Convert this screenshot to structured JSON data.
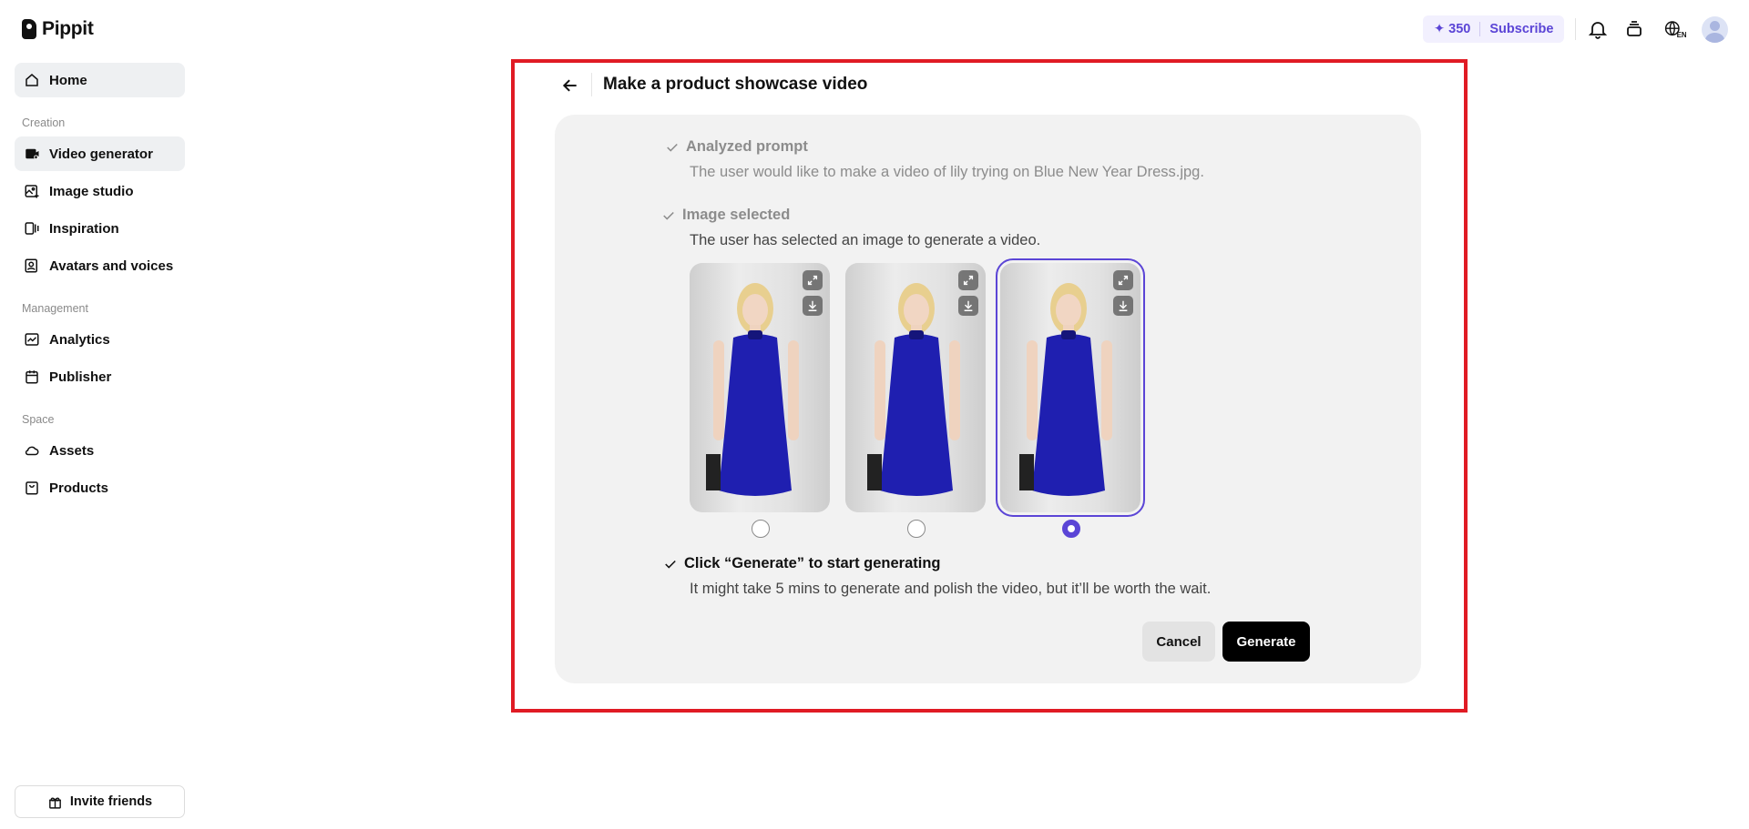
{
  "app": {
    "logo_text": "Pippit"
  },
  "sidebar": {
    "home": "Home",
    "creation_label": "Creation",
    "video_generator": "Video generator",
    "image_studio": "Image studio",
    "inspiration": "Inspiration",
    "avatars_voices": "Avatars and voices",
    "management_label": "Management",
    "analytics": "Analytics",
    "publisher": "Publisher",
    "space_label": "Space",
    "assets": "Assets",
    "products": "Products",
    "invite": "Invite friends"
  },
  "topbar": {
    "credits": "✦ 350",
    "subscribe": "Subscribe",
    "language": "EN"
  },
  "main": {
    "title": "Make a product showcase video",
    "steps": [
      {
        "title": "Analyzed prompt",
        "desc": "The user would like to make a video of lily trying on Blue New Year Dress.jpg."
      },
      {
        "title": "Image selected",
        "desc": "The user has selected an image to generate a video."
      },
      {
        "title": "Click “Generate” to start generating",
        "desc": "It might take 5 mins to generate and polish the video, but it’ll be worth the wait."
      }
    ],
    "images": [
      {
        "selected": false
      },
      {
        "selected": false
      },
      {
        "selected": true
      }
    ],
    "cancel": "Cancel",
    "generate": "Generate"
  },
  "colors": {
    "accent": "#5b45d6",
    "highlight_frame": "#e01b24",
    "card_bg": "#f2f2f2",
    "dress_blue": "#1f1fb0"
  },
  "icons": [
    "home-icon",
    "video-generator-icon",
    "image-studio-icon",
    "inspiration-icon",
    "avatar-icon",
    "analytics-icon",
    "calendar-icon",
    "cloud-icon",
    "bag-icon",
    "gift-icon",
    "bell-icon",
    "stack-icon",
    "globe-icon",
    "back-arrow-icon",
    "check-icon",
    "expand-icon",
    "download-icon"
  ]
}
